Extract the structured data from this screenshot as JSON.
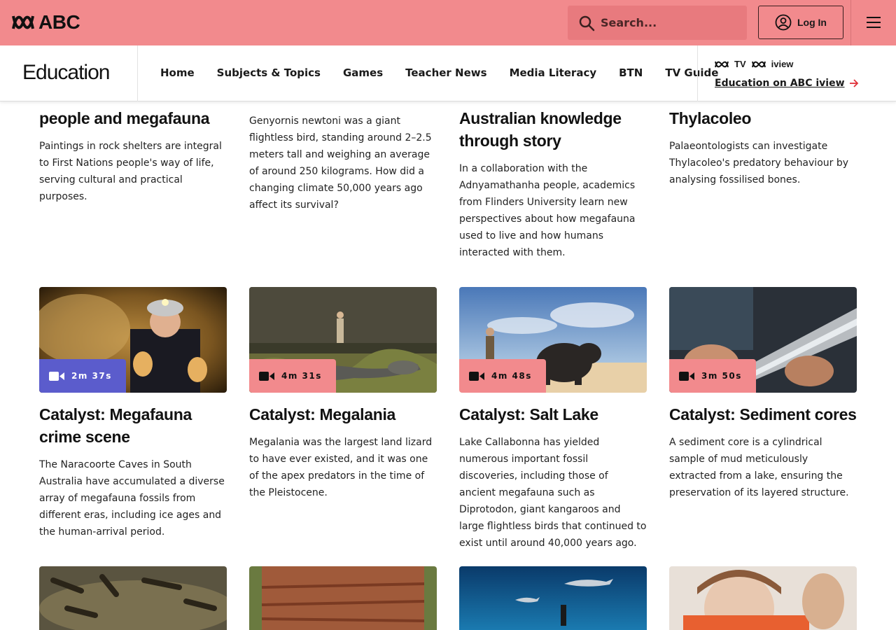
{
  "header": {
    "logo_text": "ABC",
    "search_placeholder": "Search...",
    "login_label": "Log In"
  },
  "education_nav": {
    "title": "Education",
    "items": [
      "Home",
      "Subjects & Topics",
      "Games",
      "Teacher News",
      "Media Literacy",
      "BTN",
      "TV Guide"
    ],
    "iview_tv": "TV",
    "iview_brand": "iview",
    "iview_link": "Education on ABC iview"
  },
  "top_row": [
    {
      "title_visible": "people and megafauna",
      "desc": "Paintings in rock shelters are integral to First Nations people's way of life, serving cultural and practical purposes."
    },
    {
      "title_visible": "",
      "desc": "Genyornis newtoni was a giant flightless bird, standing around 2–2.5 meters tall and weighing an average of around 250 kilograms. How did a changing climate 50,000 years ago affect its survival?"
    },
    {
      "title_visible_1": "Australian knowledge",
      "title_visible_2": "through story",
      "desc": "In a collaboration with the Adnyamathanha people, academics from Flinders University learn new perspectives about how megafauna used to live and how humans interacted with them."
    },
    {
      "title_visible": "Thylacoleo",
      "desc": "Palaeontologists can investigate Thylacoleo's predatory behaviour by analysing fossilised bones."
    }
  ],
  "cards": [
    {
      "duration": "2m 37s",
      "title": "Catalyst: Megafauna crime scene",
      "desc": "The Naracoorte Caves in South Australia have accumulated a diverse array of megafauna fossils from different eras, including ice ages and the human-arrival period.",
      "badge_color": "#5b5ccc"
    },
    {
      "duration": "4m 31s",
      "title": "Catalyst: Megalania",
      "desc": "Megalania was the largest land lizard to have ever existed, and it was one of the apex predators in the time of the Pleistocene.",
      "badge_color": "#f28a8d"
    },
    {
      "duration": "4m 48s",
      "title": "Catalyst: Salt Lake",
      "desc": "Lake Callabonna has yielded numerous important fossil discoveries, including those of ancient megafauna such as Diprotodon, giant kangaroos and large flightless birds that continued to exist until around 40,000 years ago.",
      "badge_color": "#f28a8d"
    },
    {
      "duration": "3m 50s",
      "title": "Catalyst: Sediment cores",
      "desc": "A sediment core is a cylindrical sample of mud meticulously extracted from a lake, ensuring the preservation of its layered structure.",
      "badge_color": "#f28a8d"
    }
  ],
  "colors": {
    "brand": "#f28a8d",
    "search_bg": "#e87a7e",
    "badge_blue": "#5b5ccc"
  }
}
